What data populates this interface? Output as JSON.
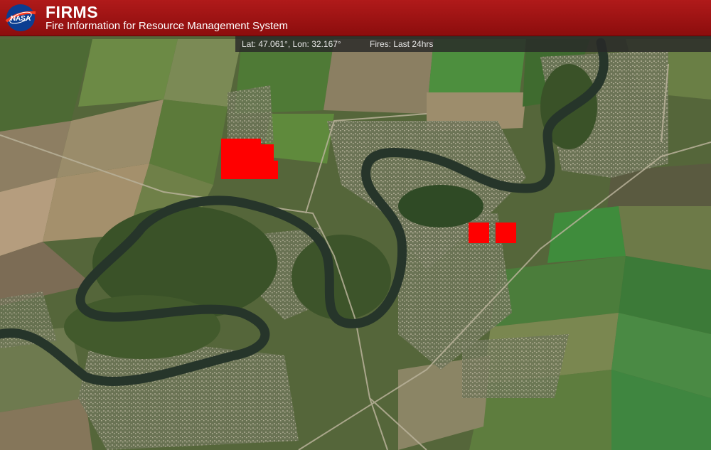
{
  "header": {
    "logo_text": "NASA",
    "title": "FIRMS",
    "subtitle": "Fire Information for Resource Management System"
  },
  "status": {
    "coordinates": "Lat: 47.061°, Lon: 32.167°",
    "fires_filter": "Fires: Last 24hrs"
  },
  "colors": {
    "header": "#a01313",
    "fire_marker": "#ff0000",
    "river": "#26352a"
  },
  "map": {
    "type": "satellite imagery",
    "fire_detections_count": 4
  }
}
